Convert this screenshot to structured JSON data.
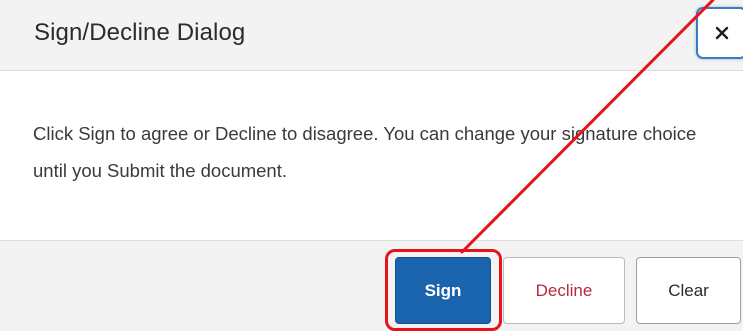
{
  "dialog": {
    "title": "Sign/Decline Dialog",
    "close_label": "×",
    "message": "Click Sign to agree or Decline to disagree. You can change your signature choice until you Submit the document."
  },
  "footer": {
    "sign_label": "Sign",
    "decline_label": "Decline",
    "clear_label": "Clear"
  },
  "colors": {
    "sign_button": "#1a64ad",
    "decline_text": "#b22d3a",
    "annotation": "#e5131c",
    "focus_ring": "#3b7bbd"
  },
  "annotation": {
    "type": "red-arrow-and-box",
    "target": "sign-button"
  }
}
